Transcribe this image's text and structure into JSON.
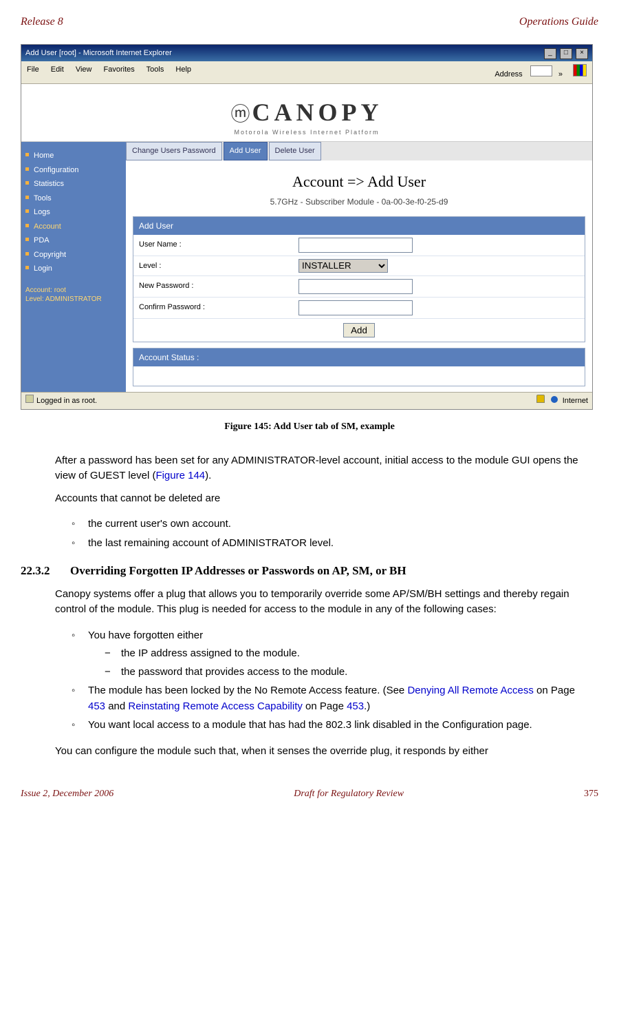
{
  "header": {
    "left": "Release 8",
    "right": "Operations Guide"
  },
  "footer": {
    "left": "Issue 2, December 2006",
    "center": "Draft for Regulatory Review",
    "right": "375"
  },
  "screenshot": {
    "window_title": "Add User [root] - Microsoft Internet Explorer",
    "menubar": [
      "File",
      "Edit",
      "View",
      "Favorites",
      "Tools",
      "Help"
    ],
    "address_label": "Address",
    "logo_main": "CANOPY",
    "logo_sub": "Motorola Wireless Internet Platform",
    "sidebar_items": [
      "Home",
      "Configuration",
      "Statistics",
      "Tools",
      "Logs",
      "Account",
      "PDA",
      "Copyright",
      "Login"
    ],
    "sidebar_active_index": 5,
    "account_label1": "Account: root",
    "account_label2": "Level: ADMINISTRATOR",
    "tabs": {
      "items": [
        "Change Users Password",
        "Add User",
        "Delete User"
      ],
      "active_index": 1
    },
    "page_title": "Account => Add User",
    "page_sub": "5.7GHz - Subscriber Module - 0a-00-3e-f0-25-d9",
    "panel1_title": "Add User",
    "form": {
      "username_label": "User Name :",
      "username_value": "",
      "level_label": "Level :",
      "level_value": "INSTALLER",
      "newpass_label": "New Password :",
      "newpass_value": "",
      "confirm_label": "Confirm Password :",
      "confirm_value": "",
      "add_button": "Add"
    },
    "panel2_title": "Account Status :",
    "status_left": "Logged in as root.",
    "status_right_lock": "🔒",
    "status_right_net": "Internet"
  },
  "caption": "Figure 145: Add User tab of SM, example",
  "body": {
    "p1a": "After a password has been set for any ADMINISTRATOR-level account, initial access to the module GUI opens the view of GUEST level (",
    "p1_link": "Figure 144",
    "p1b": ").",
    "p2": "Accounts that cannot be deleted are",
    "bul1": "the current user's own account.",
    "bul2": "the last remaining account of ADMINISTRATOR level.",
    "secnum": "22.3.2",
    "sectitle": "Overriding Forgotten IP Addresses or Passwords on AP, SM, or BH",
    "p3": "Canopy systems offer a plug that allows you to temporarily override some AP/SM/BH settings and thereby regain control of the module. This plug is needed for access to the module in any of the following cases:",
    "b1": "You have forgotten either",
    "b1a": "the IP address assigned to the module.",
    "b1b": "the password that provides access to the module.",
    "b2a": "The module has been locked by the No Remote Access feature. (See ",
    "b2link1": "Denying All Remote Access",
    "b2b": " on Page ",
    "b2page1": "453",
    "b2c": " and ",
    "b2link2": "Reinstating Remote Access Capability",
    "b2d": " on Page ",
    "b2page2": "453",
    "b2e": ".)",
    "b3": "You want local access to a module that has had the 802.3 link disabled in the Configuration page.",
    "p4": "You can configure the module such that, when it senses the override plug, it responds by either"
  }
}
